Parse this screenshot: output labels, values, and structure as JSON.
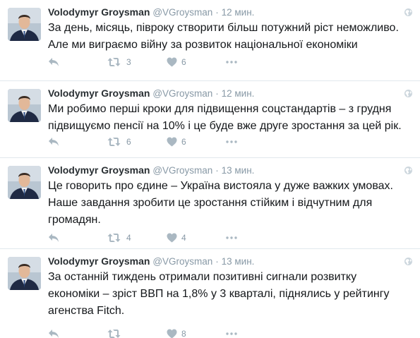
{
  "colors": {
    "secondary_text": "#8899a6",
    "icon_gray": "#aab8c2",
    "border": "#e1e8ed",
    "body_text": "#14171a"
  },
  "tweets": [
    {
      "author": {
        "fullname": "Volodymyr Groysman",
        "username": "@VGroysman"
      },
      "separator": "·",
      "time": "12 мин.",
      "text": "За день, місяць, півроку створити більш потужний ріст неможливо.\nАле ми виграємо війну за розвиток національної економіки",
      "retweets": "3",
      "likes": "6"
    },
    {
      "author": {
        "fullname": "Volodymyr Groysman",
        "username": "@VGroysman"
      },
      "separator": "·",
      "time": "12 мин.",
      "text": "Ми робимо перші кроки для підвищення соцстандартів – з грудня\nпідвищуємо пенсії на 10% і це буде вже друге зростання за цей рік.",
      "retweets": "6",
      "likes": "6"
    },
    {
      "author": {
        "fullname": "Volodymyr Groysman",
        "username": "@VGroysman"
      },
      "separator": "·",
      "time": "13 мин.",
      "text": "Це говорить про єдине – Україна вистояла у дуже важких умовах.\nНаше завдання зробити це зростання стійким і відчутним для\nгромадян.",
      "retweets": "4",
      "likes": "4"
    },
    {
      "author": {
        "fullname": "Volodymyr Groysman",
        "username": "@VGroysman"
      },
      "separator": "·",
      "time": "13 мин.",
      "text": "За останній тиждень отримали позитивні сигнали розвитку\nекономіки – зріст ВВП на 1,8% у 3 кварталі, піднялись у рейтингу\nагенства Fitch.",
      "retweets": "",
      "likes": "8"
    }
  ],
  "icons": {
    "reply": "reply-icon",
    "retweet": "retweet-icon",
    "like": "heart-icon",
    "more": "more-dots-icon",
    "globe": "globe-icon"
  }
}
